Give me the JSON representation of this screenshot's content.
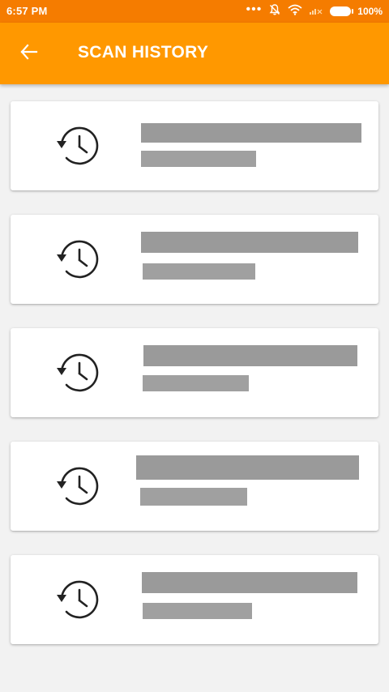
{
  "status_bar": {
    "time": "6:57 PM",
    "battery_percent": "100%",
    "icons": [
      "more-dots-icon",
      "silent-bell-icon",
      "wifi-icon",
      "no-signal-icon",
      "battery-icon"
    ]
  },
  "app_bar": {
    "title": "SCAN HISTORY",
    "back_icon": "arrow-back-icon"
  },
  "history": {
    "item_icon": "history-clock-icon",
    "items": [
      {
        "id": 1,
        "primary_redacted": true,
        "secondary_redacted": true
      },
      {
        "id": 2,
        "primary_redacted": true,
        "secondary_redacted": true
      },
      {
        "id": 3,
        "primary_redacted": true,
        "secondary_redacted": true
      },
      {
        "id": 4,
        "primary_redacted": true,
        "secondary_redacted": true
      },
      {
        "id": 5,
        "primary_redacted": true,
        "secondary_redacted": true
      }
    ]
  },
  "colors": {
    "status_bar": "#f57c00",
    "app_bar": "#ff9800",
    "background": "#f2f2f2",
    "redaction": "#9a9a9a"
  }
}
